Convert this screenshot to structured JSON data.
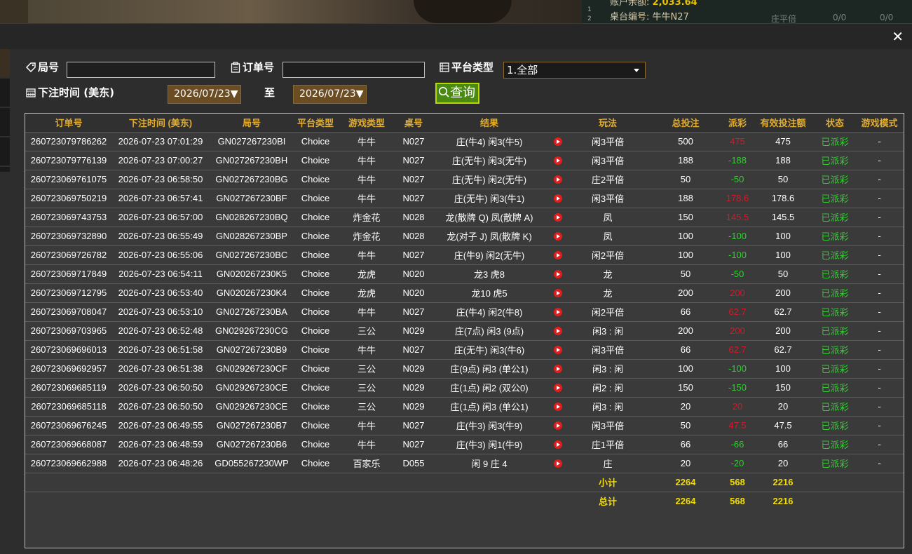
{
  "background": {
    "balance_label": "账户余额:",
    "balance_value": "2,033.64",
    "table_label": "桌台编号: 牛牛N27",
    "side_1": "1",
    "side_2": "2",
    "side_mode": "庄平倍",
    "side_a": "0/0",
    "side_b": "0/0"
  },
  "filters": {
    "round_label": "局号",
    "round_value": "",
    "order_label": "订单号",
    "order_value": "",
    "platform_label": "平台类型",
    "platform_value": "1.全部",
    "time_label": "下注时间 (美东)",
    "date_from": "2026/07/23",
    "to_label": "至",
    "date_to": "2026/07/23",
    "query_label": "查询"
  },
  "table": {
    "headers": [
      "订单号",
      "下注时间 (美东)",
      "局号",
      "平台类型",
      "游戏类型",
      "桌号",
      "结果",
      "",
      "玩法",
      "总投注",
      "派彩",
      "有效投注额",
      "状态",
      "游戏模式"
    ],
    "rows": [
      [
        "260723079786262",
        "2026-07-23 07:01:29",
        "GN027267230BI",
        "Choice",
        "牛牛",
        "N027",
        "庄(牛4) 闲3(牛5)",
        "闲3平倍",
        "500",
        "475",
        "475",
        "已派彩",
        "-"
      ],
      [
        "260723079776139",
        "2026-07-23 07:00:27",
        "GN027267230BH",
        "Choice",
        "牛牛",
        "N027",
        "庄(无牛) 闲3(无牛)",
        "闲3平倍",
        "188",
        "-188",
        "188",
        "已派彩",
        "-"
      ],
      [
        "260723069761075",
        "2026-07-23 06:58:50",
        "GN027267230BG",
        "Choice",
        "牛牛",
        "N027",
        "庄(无牛) 闲2(无牛)",
        "庄2平倍",
        "50",
        "-50",
        "50",
        "已派彩",
        "-"
      ],
      [
        "260723069750219",
        "2026-07-23 06:57:41",
        "GN027267230BF",
        "Choice",
        "牛牛",
        "N027",
        "庄(无牛) 闲3(牛1)",
        "闲3平倍",
        "188",
        "178.6",
        "178.6",
        "已派彩",
        "-"
      ],
      [
        "260723069743753",
        "2026-07-23 06:57:00",
        "GN028267230BQ",
        "Choice",
        "炸金花",
        "N028",
        "龙(散牌 Q) 凤(散牌 A)",
        "凤",
        "150",
        "145.5",
        "145.5",
        "已派彩",
        "-"
      ],
      [
        "260723069732890",
        "2026-07-23 06:55:49",
        "GN028267230BP",
        "Choice",
        "炸金花",
        "N028",
        "龙(对子 J) 凤(散牌 K)",
        "凤",
        "100",
        "-100",
        "100",
        "已派彩",
        "-"
      ],
      [
        "260723069726782",
        "2026-07-23 06:55:06",
        "GN027267230BC",
        "Choice",
        "牛牛",
        "N027",
        "庄(牛9) 闲2(无牛)",
        "闲2平倍",
        "100",
        "-100",
        "100",
        "已派彩",
        "-"
      ],
      [
        "260723069717849",
        "2026-07-23 06:54:11",
        "GN020267230K5",
        "Choice",
        "龙虎",
        "N020",
        "龙3 虎8",
        "龙",
        "50",
        "-50",
        "50",
        "已派彩",
        "-"
      ],
      [
        "260723069712795",
        "2026-07-23 06:53:40",
        "GN020267230K4",
        "Choice",
        "龙虎",
        "N020",
        "龙10 虎5",
        "龙",
        "200",
        "200",
        "200",
        "已派彩",
        "-"
      ],
      [
        "260723069708047",
        "2026-07-23 06:53:10",
        "GN027267230BA",
        "Choice",
        "牛牛",
        "N027",
        "庄(牛4) 闲2(牛8)",
        "闲2平倍",
        "66",
        "62.7",
        "62.7",
        "已派彩",
        "-"
      ],
      [
        "260723069703965",
        "2026-07-23 06:52:48",
        "GN029267230CG",
        "Choice",
        "三公",
        "N029",
        "庄(7点) 闲3 (9点)",
        "闲3 : 闲",
        "200",
        "200",
        "200",
        "已派彩",
        "-"
      ],
      [
        "260723069696013",
        "2026-07-23 06:51:58",
        "GN027267230B9",
        "Choice",
        "牛牛",
        "N027",
        "庄(无牛) 闲3(牛6)",
        "闲3平倍",
        "66",
        "62.7",
        "62.7",
        "已派彩",
        "-"
      ],
      [
        "260723069692957",
        "2026-07-23 06:51:38",
        "GN029267230CF",
        "Choice",
        "三公",
        "N029",
        "庄(9点) 闲3 (单公1)",
        "闲3 : 闲",
        "100",
        "-100",
        "100",
        "已派彩",
        "-"
      ],
      [
        "260723069685119",
        "2026-07-23 06:50:50",
        "GN029267230CE",
        "Choice",
        "三公",
        "N029",
        "庄(1点) 闲2 (双公0)",
        "闲2 : 闲",
        "150",
        "-150",
        "150",
        "已派彩",
        "-"
      ],
      [
        "260723069685118",
        "2026-07-23 06:50:50",
        "GN029267230CE",
        "Choice",
        "三公",
        "N029",
        "庄(1点) 闲3 (单公1)",
        "闲3 : 闲",
        "20",
        "20",
        "20",
        "已派彩",
        "-"
      ],
      [
        "260723069676245",
        "2026-07-23 06:49:55",
        "GN027267230B7",
        "Choice",
        "牛牛",
        "N027",
        "庄(牛3) 闲3(牛9)",
        "闲3平倍",
        "50",
        "47.5",
        "47.5",
        "已派彩",
        "-"
      ],
      [
        "260723069668087",
        "2026-07-23 06:48:59",
        "GN027267230B6",
        "Choice",
        "牛牛",
        "N027",
        "庄(牛3) 闲1(牛9)",
        "庄1平倍",
        "66",
        "-66",
        "66",
        "已派彩",
        "-"
      ],
      [
        "260723069662988",
        "2026-07-23 06:48:26",
        "GD055267230WP",
        "Choice",
        "百家乐",
        "D055",
        "闲 9 庄 4",
        "庄",
        "20",
        "-20",
        "20",
        "已派彩",
        "-"
      ]
    ],
    "subtotal": {
      "label": "小计",
      "bet": "2264",
      "payout": "568",
      "valid": "2216"
    },
    "total": {
      "label": "总计",
      "bet": "2264",
      "payout": "568",
      "valid": "2216"
    }
  },
  "colors": {
    "header_text": "#e2ad2f",
    "positive_payout": "#d4192a",
    "negative_payout": "#2fcf2f",
    "status": "#2fcf2f",
    "summary": "#f2dc00"
  }
}
